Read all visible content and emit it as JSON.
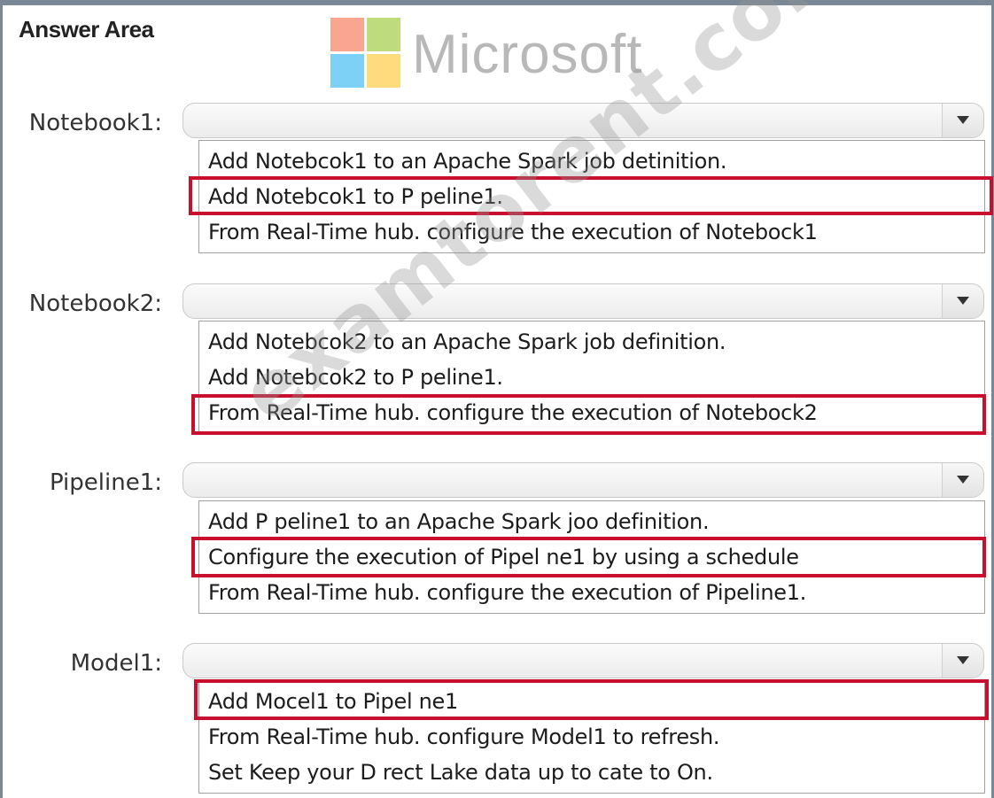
{
  "title": "Answer Area",
  "logo": {
    "text": "Microsoft",
    "colors": [
      "#f25022",
      "#7fba00",
      "#00a4ef",
      "#ffb900"
    ]
  },
  "watermark": "examtorent.com",
  "highlight_color": "#c8102e",
  "groups": [
    {
      "label": "Notebook1:",
      "selected": "",
      "options": [
        "Add Notebcok1 to an Apache Spark job detinition.",
        "Add Notebcok1 to P peline1.",
        "From Real-Time hub. configure the execution of Notebock1"
      ],
      "highlighted_index": 1
    },
    {
      "label": "Notebook2:",
      "selected": "",
      "options": [
        "Add Notebcok2 to an Apache Spark job definition.",
        "Add Notebcok2 to P peline1.",
        "From Real-Time hub. configure the execution of Notebock2"
      ],
      "highlighted_index": 2
    },
    {
      "label": "Pipeline1:",
      "selected": "",
      "options": [
        "Add P peline1 to an Apache Spark joo definition.",
        "Configure the execution of Pipel ne1 by using a schedule",
        "From Real-Time hub. configure the execution of Pipeline1."
      ],
      "highlighted_index": 1
    },
    {
      "label": "Model1:",
      "selected": "",
      "options": [
        "Add Mocel1 to Pipel ne1",
        "From Real-Time hub. configure Model1 to refresh.",
        "Set Keep your D rect Lake data up to cate to On."
      ],
      "highlighted_index": 0
    }
  ]
}
